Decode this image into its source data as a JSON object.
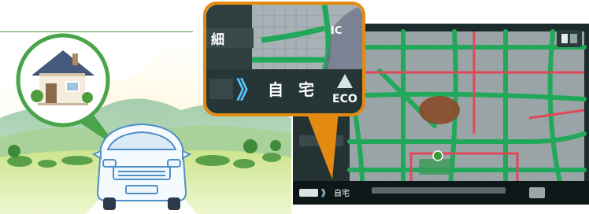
{
  "zoom": {
    "top_label": "細",
    "button_arrows": "》",
    "home_label": "自 宅",
    "eco_label": "ECO",
    "ic_label": "IC"
  },
  "map": {
    "top_right_icon": "map-view-icon"
  },
  "colors": {
    "accent_orange": "#e28a12",
    "headline_green": "#4c9a3d",
    "road_green": "#22a85a",
    "road_red": "#e0485a",
    "home_pin_green": "#3a9a3a"
  }
}
